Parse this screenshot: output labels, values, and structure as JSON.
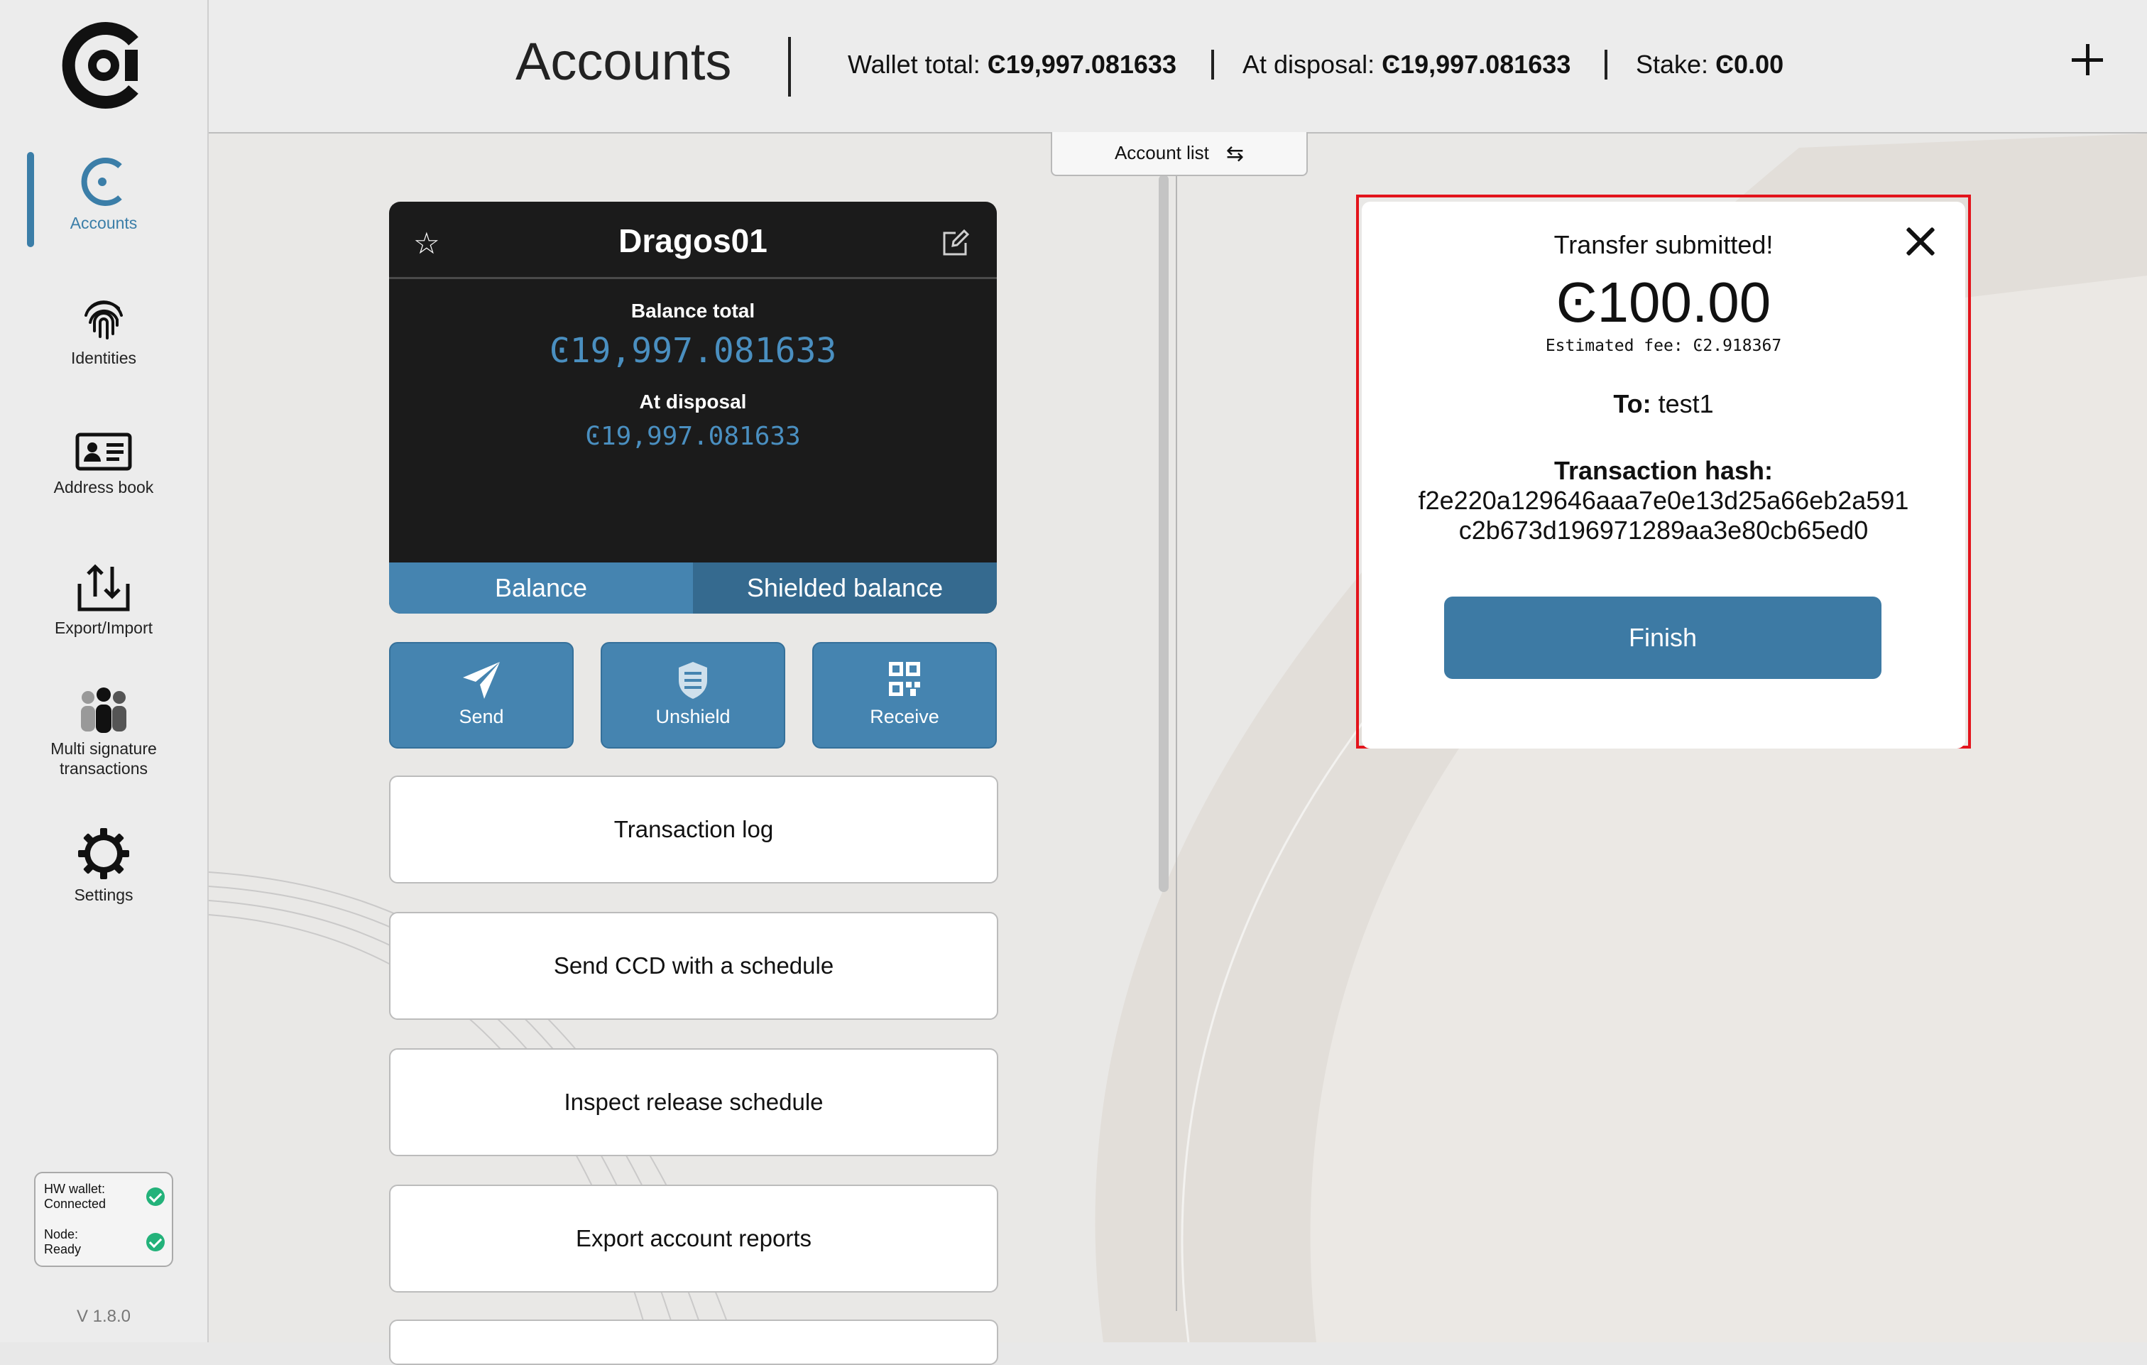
{
  "app": {
    "version": "V 1.8.0",
    "accent": "#3b7ea8",
    "highlight": "#e3141c"
  },
  "sidebar": {
    "items": [
      {
        "label": "Accounts",
        "icon": "concordium-c-icon"
      },
      {
        "label": "Identities",
        "icon": "fingerprint-icon"
      },
      {
        "label": "Address book",
        "icon": "address-card-icon"
      },
      {
        "label": "Export/Import",
        "icon": "export-import-icon"
      },
      {
        "label": "Multi signature",
        "label2": "transactions",
        "icon": "people-group-icon"
      },
      {
        "label": "Settings",
        "icon": "gear-icon"
      }
    ],
    "status": {
      "hw_label": "HW wallet:",
      "hw_value": "Connected",
      "node_label": "Node:",
      "node_value": "Ready"
    }
  },
  "header": {
    "title": "Accounts",
    "wallet_total_label": "Wallet total: ",
    "wallet_total_value": "Ͼ19,997.081633",
    "at_disposal_label": "At disposal: ",
    "at_disposal_value": "Ͼ19,997.081633",
    "stake_label": "Stake: ",
    "stake_value": "Ͼ0.00"
  },
  "account_list_tab": {
    "label": "Account list",
    "icon": "swap-arrows-icon"
  },
  "account_card": {
    "name": "Dragos01",
    "balance_total_label": "Balance total",
    "balance_total": "Ͼ19,997.081633",
    "at_disposal_label": "At disposal",
    "at_disposal": "Ͼ19,997.081633",
    "tabs": [
      "Balance",
      "Shielded balance"
    ]
  },
  "actions": [
    {
      "label": "Send",
      "icon": "paper-plane-icon"
    },
    {
      "label": "Unshield",
      "icon": "shield-icon"
    },
    {
      "label": "Receive",
      "icon": "qr-code-icon"
    }
  ],
  "menu_buttons": [
    "Transaction log",
    "Send CCD with a schedule",
    "Inspect release schedule",
    "Export account reports"
  ],
  "dialog": {
    "title": "Transfer submitted!",
    "amount": "Ͼ100.00",
    "fee": "Estimated fee: Ͼ2.918367",
    "to_label": "To:",
    "to_value": " test1",
    "hash_label": "Transaction hash:",
    "hash_line1": "f2e220a129646aaa7e0e13d25a66eb2a591",
    "hash_line2": "c2b673d196971289aa3e80cb65ed0",
    "finish_label": "Finish"
  }
}
